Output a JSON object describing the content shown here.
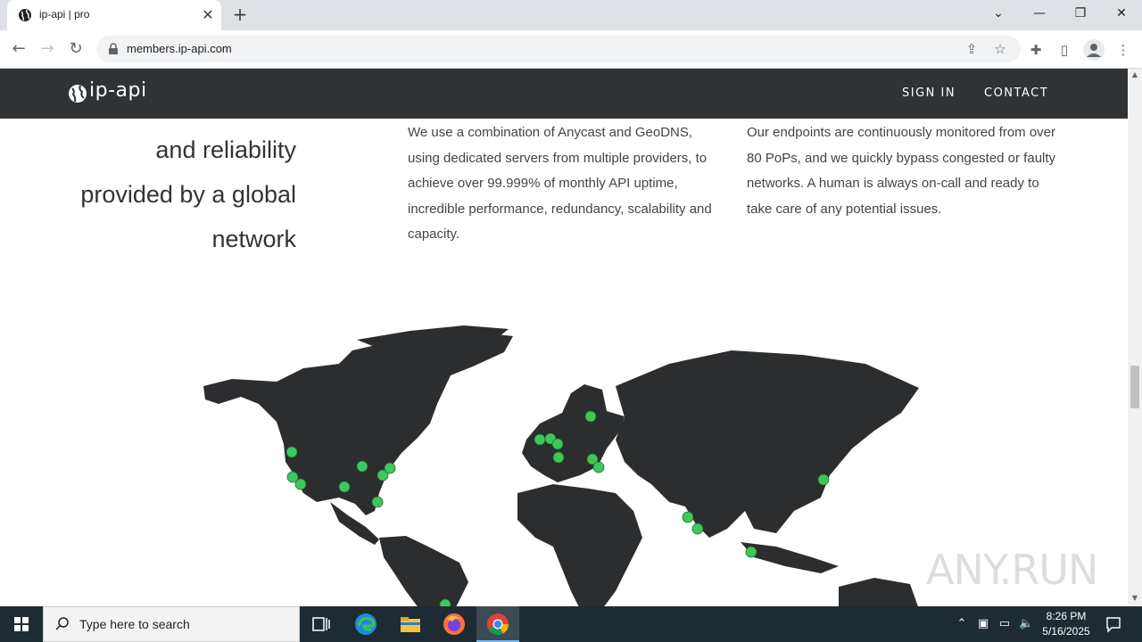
{
  "browser": {
    "tab_title": "ip-api | pro",
    "url": "members.ip-api.com",
    "new_tab_glyph": "+",
    "close_glyph": "✕"
  },
  "site": {
    "logo_text": "ip-api",
    "nav": {
      "sign_in": "SIGN IN",
      "contact": "CONTACT"
    }
  },
  "content": {
    "hero_lines": [
      "and reliability",
      "provided by a global",
      "network"
    ],
    "col1": "We use a combination of Anycast and GeoDNS, using dedicated servers from multiple providers, to achieve over 99.999% of monthly API uptime, incredible performance, redundancy, scalability and capacity.",
    "col2": "Our endpoints are continuously monitored from over 80 PoPs, and we quickly bypass congested or faulty networks. A human is always on-call and ready to take care of any potential issues.",
    "map_marker_color": "#3ec75b"
  },
  "watermark": "ANY.RUN",
  "taskbar": {
    "search_placeholder": "Type here to search",
    "time": "8:26 PM",
    "date": "5/16/2025"
  }
}
